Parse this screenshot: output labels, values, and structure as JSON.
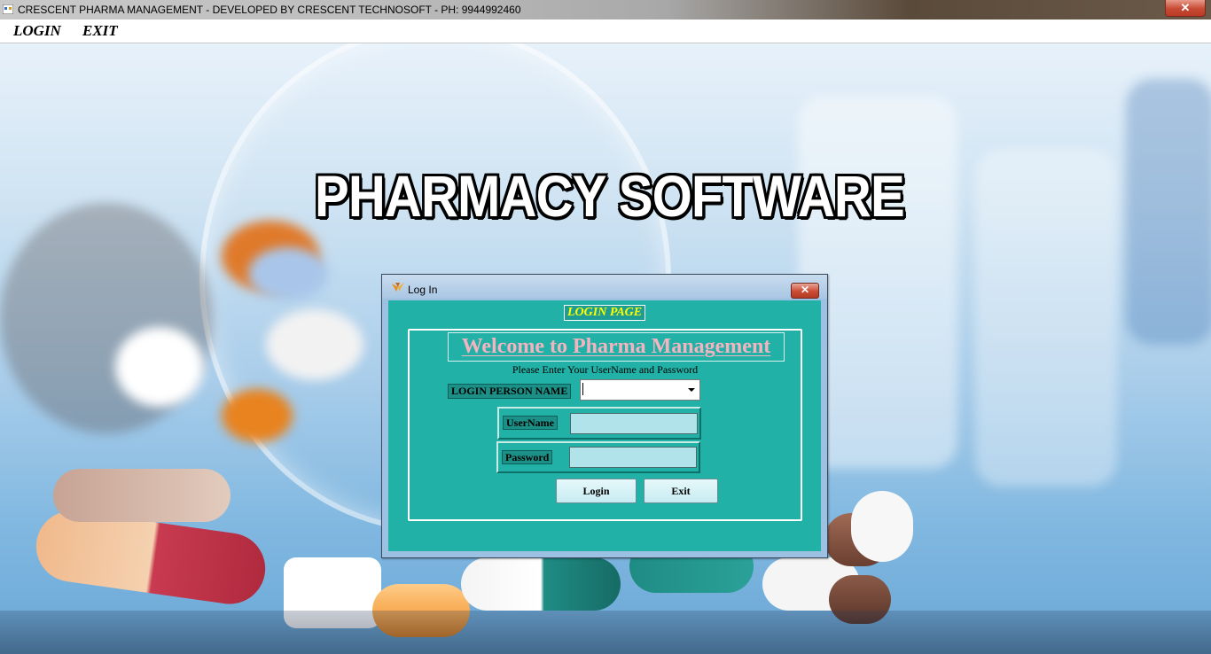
{
  "window": {
    "title": "CRESCENT PHARMA MANAGEMENT - DEVELOPED BY CRESCENT TECHNOSOFT - PH: 9944992460",
    "close_symbol": "✕",
    "icon": "app-window-icon"
  },
  "menu": {
    "items": [
      {
        "label": "LOGIN"
      },
      {
        "label": "EXIT"
      }
    ]
  },
  "background": {
    "heading": "PHARMACY SOFTWARE"
  },
  "dialog": {
    "title": "Log In",
    "icon": "app-logo-icon",
    "close_symbol": "✕",
    "page_label": "LOGIN PAGE",
    "welcome": "Welcome to Pharma Management",
    "instruction": "Please Enter Your UserName and Password",
    "person_label": "LOGIN PERSON NAME",
    "person_value": "",
    "username_label": "UserName",
    "username_value": "",
    "password_label": "Password",
    "password_value": "",
    "login_button": "Login",
    "exit_button": "Exit"
  },
  "colors": {
    "dialog_body": "#21b1a7",
    "page_label_text": "#ffff00",
    "welcome_text": "#f3b4c0",
    "input_background": "#b0e4ea"
  }
}
